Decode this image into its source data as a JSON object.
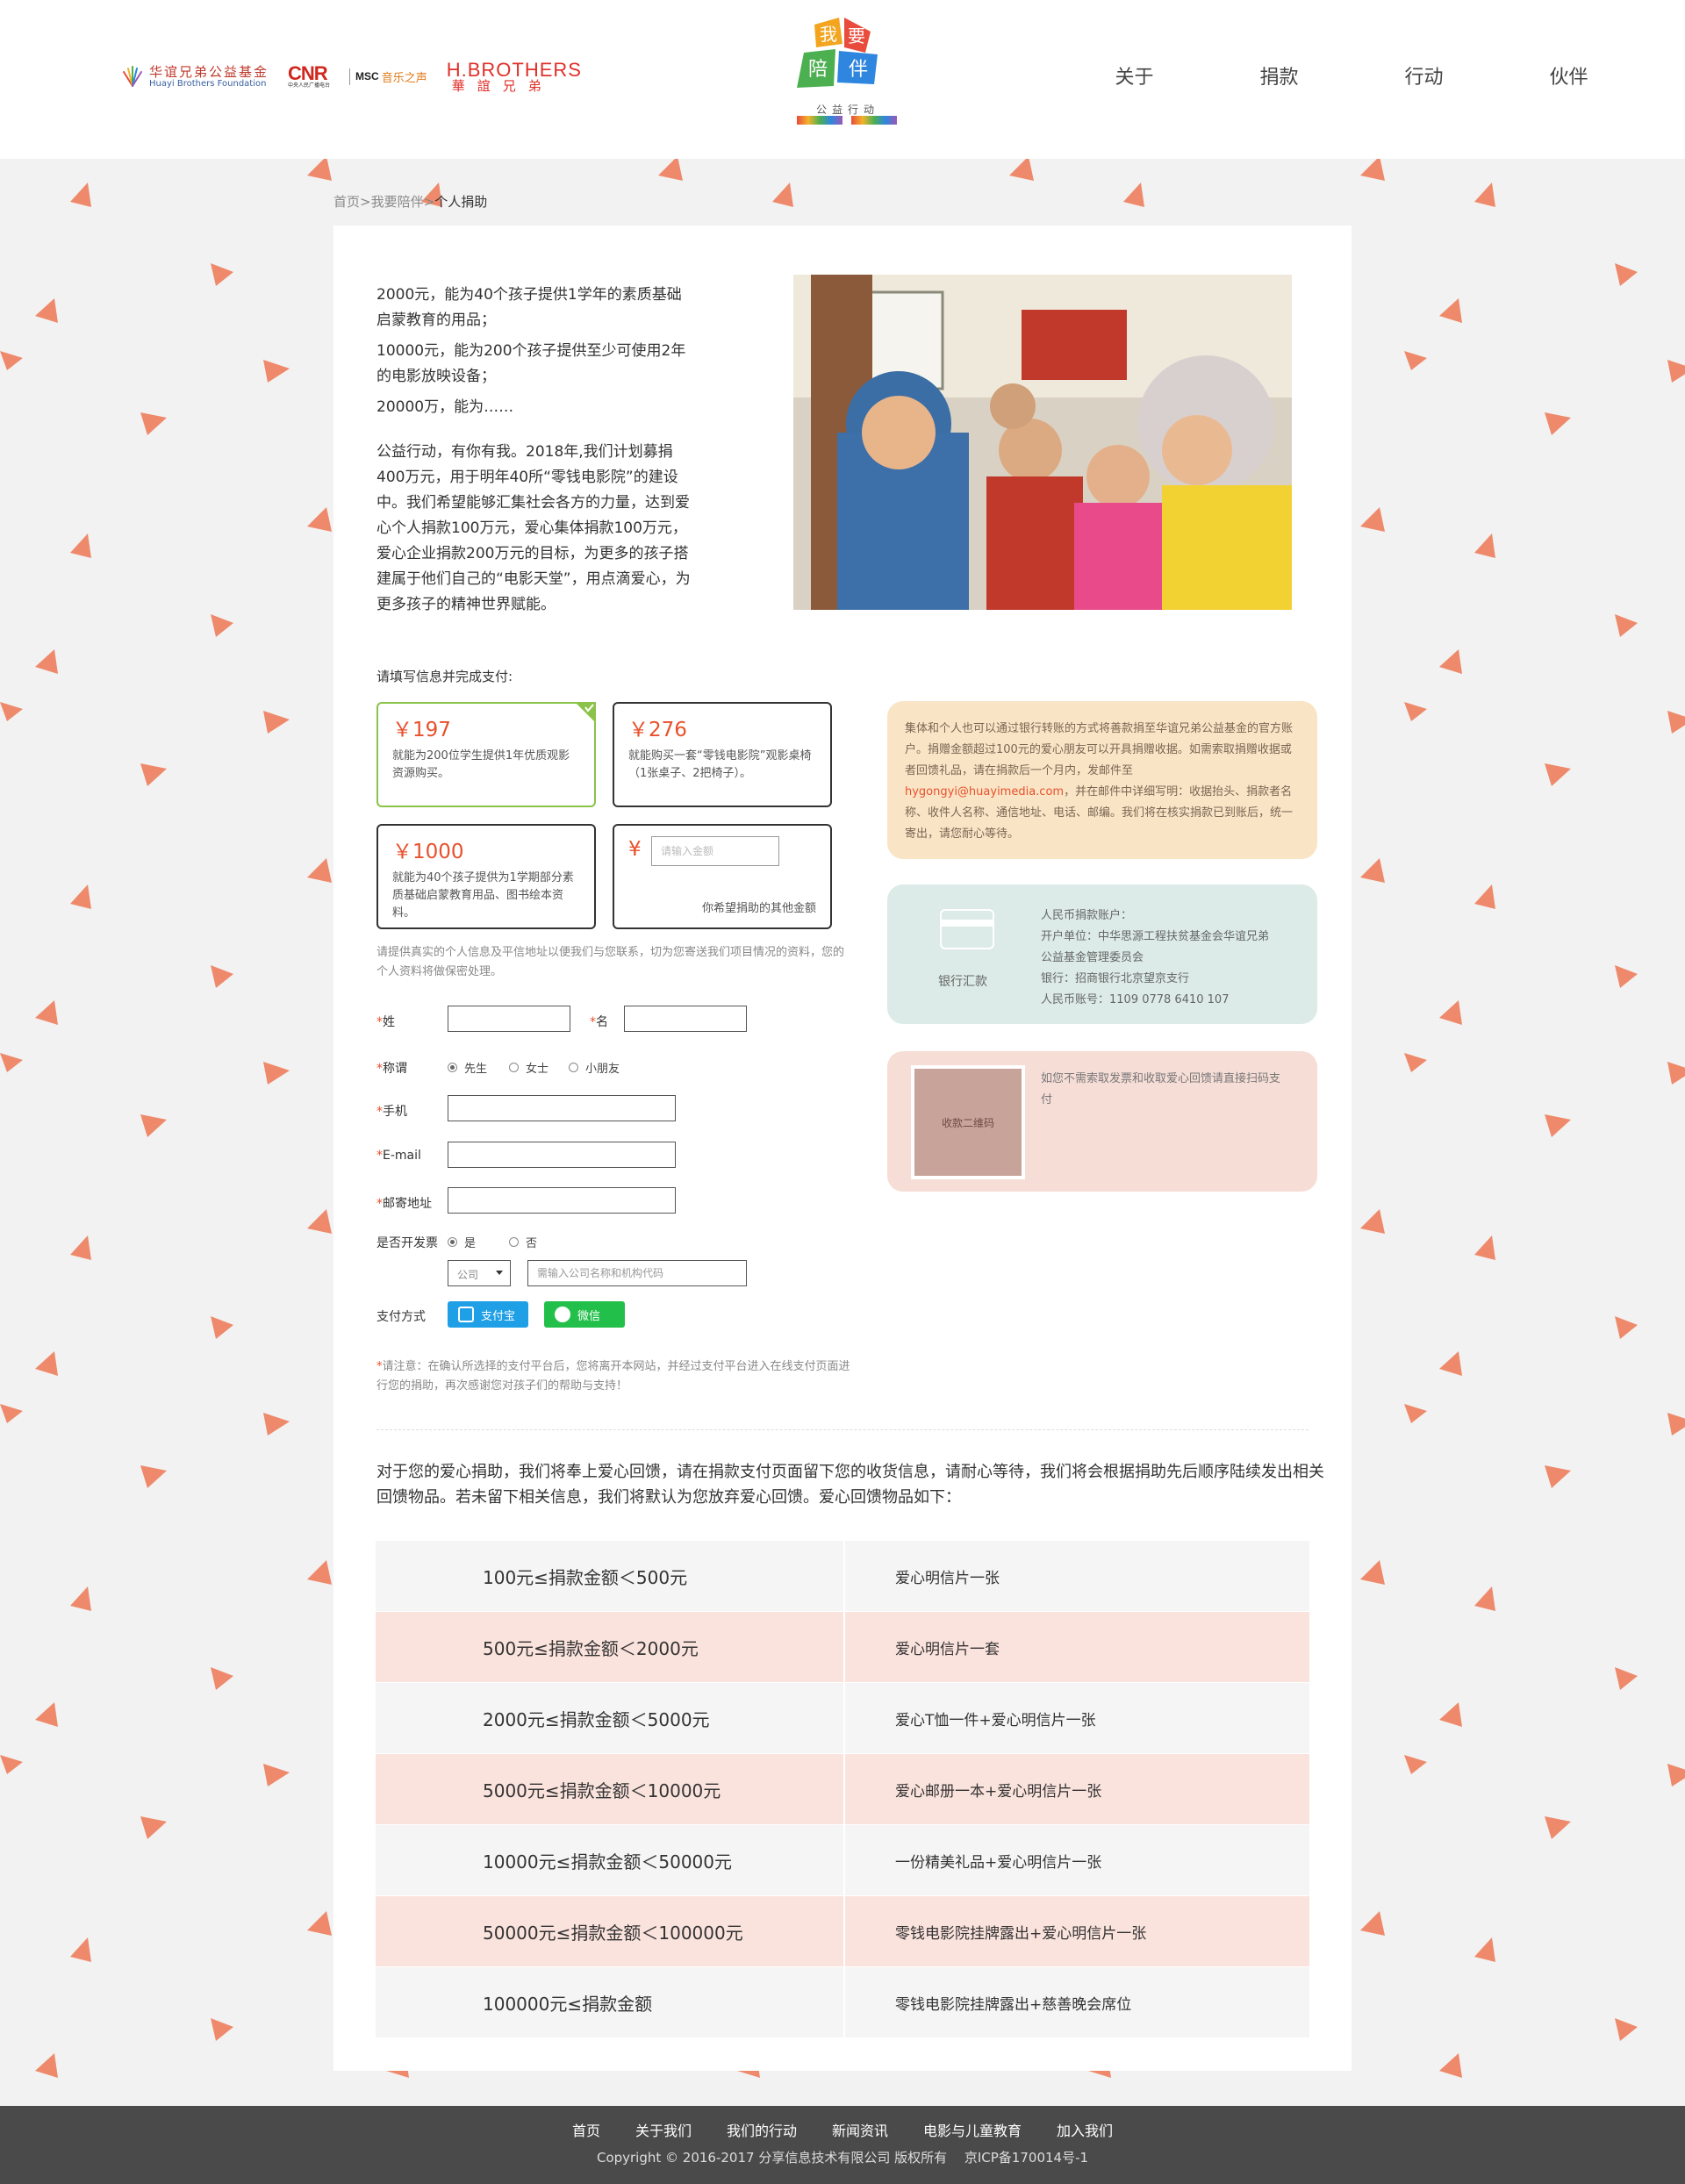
{
  "header": {
    "partners": {
      "huayi_zh": "华谊兄弟公益基金",
      "huayi_en": "Huayi Brothers Foundation",
      "cnr": "CNR",
      "cnr_sub": "中央人民广播电台",
      "music_mark": "MSC",
      "music_zh": "音乐之声",
      "hb_en": "H.BROTHERS",
      "hb_zh": "華誼兄弟"
    },
    "logo": {
      "title": "我要陪伴",
      "sub": "公益行动"
    },
    "nav": [
      "关于",
      "捐款",
      "行动",
      "伙伴"
    ]
  },
  "breadcrumb": {
    "home": "首页",
    "sep": ">",
    "parent": "我要陪伴",
    "current": "个人捐助"
  },
  "intro": [
    "2000元，能为40个孩子提供1学年的素质基础启蒙教育的用品；",
    "10000元，能为200个孩子提供至少可使用2年的电影放映设备；",
    "20000万，能为……",
    "公益行动，有你有我。2018年,我们计划募捐400万元，用于明年40所“零钱电影院”的建设中。我们希望能够汇集社会各方的力量，达到爱心个人捐款100万元，爱心集体捐款100万元，爱心企业捐款200万元的目标，为更多的孩子搭建属于他们自己的“电影天堂”，用点滴爱心，为更多孩子的精神世界赋能。"
  ],
  "form": {
    "title": "请填写信息并完成支付:",
    "options": [
      {
        "amount": "￥197",
        "desc": "就能为200位学生提供1年优质观影资源购买。",
        "selected": true
      },
      {
        "amount": "￥276",
        "desc": "就能购买一套“零钱电影院”观影桌椅（1张桌子、2把椅子）。",
        "selected": false
      },
      {
        "amount": "￥1000",
        "desc": "就能为40个孩子提供为1学期部分素质基础启蒙教育用品、图书绘本资料。",
        "selected": false
      }
    ],
    "custom": {
      "currency": "¥",
      "placeholder": "请输入金额",
      "label": "你希望捐助的其他金额"
    },
    "privacy": "请提供真实的个人信息及平信地址以便我们与您联系，切为您寄送我们项目情况的资料，您的个人资料将做保密处理。",
    "required_mark": "*",
    "labels": {
      "surname": "姓",
      "given": "名",
      "title": "称谓",
      "phone": "手机",
      "email": "E-mail",
      "address": "邮寄地址",
      "invoice": "是否开发票",
      "payment": "支付方式"
    },
    "title_options": [
      "先生",
      "女士",
      "小朋友"
    ],
    "invoice_options": [
      "是",
      "否"
    ],
    "invoice_type": "公司",
    "invoice_placeholder": "需输入公司名称和机构代码",
    "pay_alipay": "支付宝",
    "pay_wechat": "微信",
    "notice_mark": "*",
    "notice": "请注意：在确认所选择的支付平台后，您将离开本网站，并经过支付平台进入在线支付页面进行您的捐助，再次感谢您对孩子们的帮助与支持！"
  },
  "panels": {
    "bank_note_pre": "集体和个人也可以通过银行转账的方式将善款捐至华谊兄弟公益基金的官方账户。捐赠金额超过100元的爱心朋友可以开具捐赠收据。如需索取捐赠收据或者回馈礼品，请在捐款后一个月内，发邮件至",
    "bank_note_email": "hygongyi@huayimedia.com",
    "bank_note_post": "，并在邮件中详细写明：收据抬头、捐款者名称、收件人名称、通信地址、电话、邮编。我们将在核实捐款已到账后，统一寄出，请您耐心等待。",
    "transfer_label": "银行汇款",
    "account_lines": [
      "人民币捐款账户：",
      "开户单位：中华思源工程扶贫基金会华谊兄弟",
      "公益基金管理委员会",
      "银行：招商银行北京望京支行",
      "人民币账号：1109 0778 6410 107"
    ],
    "qr_label": "收款二维码",
    "qr_note": "如您不需索取发票和收取爱心回馈请直接扫码支付"
  },
  "rewards": {
    "intro": "对于您的爱心捐助，我们将奉上爱心回馈，请在捐款支付页面留下您的收货信息，请耐心等待，我们将会根据捐助先后顺序陆续发出相关回馈物品。若未留下相关信息，我们将默认为您放弃爱心回馈。爱心回馈物品如下：",
    "rows": [
      {
        "range": "100元≤捐款金额＜500元",
        "gift": "爱心明信片一张"
      },
      {
        "range": "500元≤捐款金额＜2000元",
        "gift": "爱心明信片一套"
      },
      {
        "range": "2000元≤捐款金额＜5000元",
        "gift": "爱心T恤一件+爱心明信片一张"
      },
      {
        "range": "5000元≤捐款金额＜10000元",
        "gift": "爱心邮册一本+爱心明信片一张"
      },
      {
        "range": "10000元≤捐款金额＜50000元",
        "gift": "一份精美礼品+爱心明信片一张"
      },
      {
        "range": "50000元≤捐款金额＜100000元",
        "gift": "零钱电影院挂牌露出+爱心明信片一张"
      },
      {
        "range": "100000元≤捐款金额",
        "gift": "零钱电影院挂牌露出+慈善晚会席位"
      }
    ]
  },
  "footer": {
    "links": [
      "首页",
      "关于我们",
      "我们的行动",
      "新闻资讯",
      "电影与儿童教育",
      "加入我们"
    ],
    "copyright": "Copyright © 2016-2017 分享信息技术有限公司 版权所有　 京ICP备170014号-1"
  }
}
